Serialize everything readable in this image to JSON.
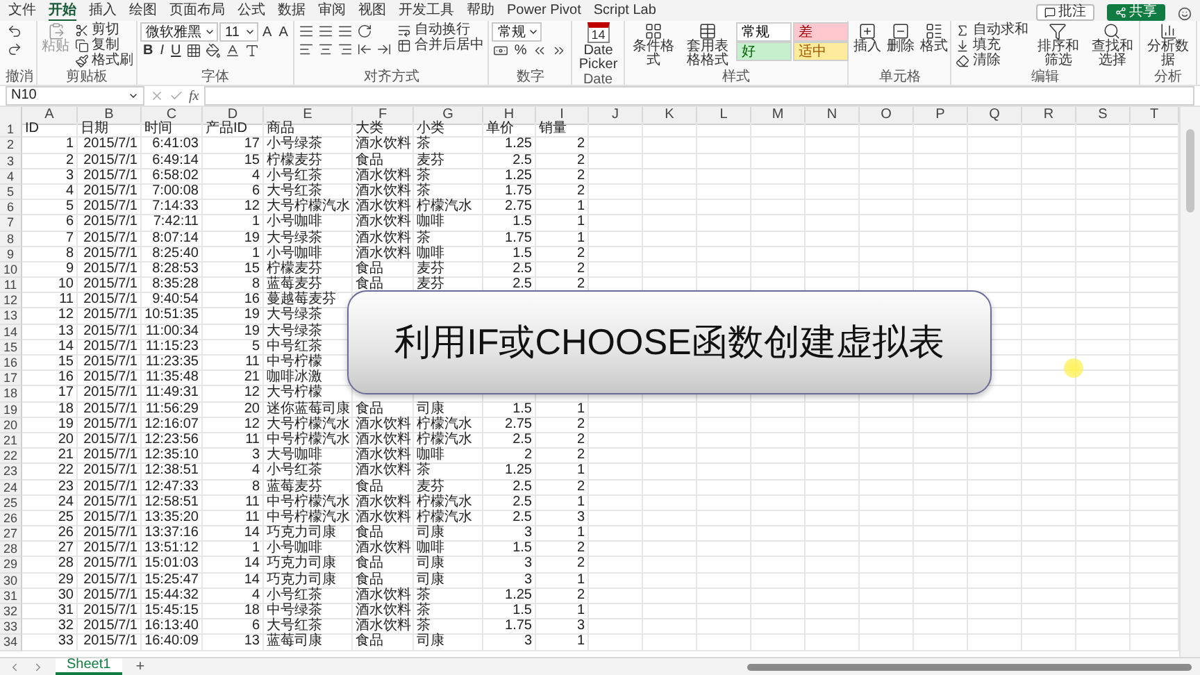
{
  "ribbon_tabs": [
    {
      "label": "文件",
      "selected": false
    },
    {
      "label": "开始",
      "selected": true
    },
    {
      "label": "插入",
      "selected": false
    },
    {
      "label": "绘图",
      "selected": false
    },
    {
      "label": "页面布局",
      "selected": false
    },
    {
      "label": "公式",
      "selected": false
    },
    {
      "label": "数据",
      "selected": false
    },
    {
      "label": "审阅",
      "selected": false
    },
    {
      "label": "视图",
      "selected": false
    },
    {
      "label": "开发工具",
      "selected": false
    },
    {
      "label": "帮助",
      "selected": false
    },
    {
      "label": "Power Pivot",
      "selected": false
    },
    {
      "label": "Script Lab",
      "selected": false
    }
  ],
  "header_buttons": [
    {
      "kind": "comments",
      "label": "批注"
    },
    {
      "kind": "share",
      "label": "共享"
    }
  ],
  "ribbon": [
    {
      "label": "撤消",
      "columns": [
        [
          [
            {
              "kind": "icon"
            }
          ],
          [
            {
              "kind": "icon"
            }
          ]
        ]
      ]
    },
    {
      "label": "剪贴板",
      "columns": [
        [
          [
            {
              "kind": "big",
              "label": "粘贴",
              "disabled": true
            }
          ]
        ],
        [
          [
            {
              "kind": "small",
              "label": "剪切"
            }
          ],
          [
            {
              "kind": "small",
              "label": "复制"
            }
          ],
          [
            {
              "kind": "small",
              "label": "格式刷"
            }
          ]
        ]
      ]
    },
    {
      "label": "字体",
      "columns": [
        [
          [
            {
              "kind": "field",
              "value": "微软雅黑"
            },
            {
              "kind": "field",
              "value": "11"
            },
            {
              "kind": "text",
              "label": "A"
            },
            {
              "kind": "text",
              "label": "A"
            }
          ],
          [
            {
              "kind": "bold",
              "label": "B"
            },
            {
              "kind": "italic",
              "label": "I"
            },
            {
              "kind": "underline",
              "label": "U"
            },
            {
              "kind": "icon"
            },
            {
              "kind": "icon"
            },
            {
              "kind": "icon"
            },
            {
              "kind": "icon"
            }
          ]
        ]
      ]
    },
    {
      "label": "对齐方式",
      "columns": [
        [
          [
            {
              "kind": "icon"
            },
            {
              "kind": "icon"
            },
            {
              "kind": "icon"
            },
            {
              "kind": "icon"
            }
          ],
          [
            {
              "kind": "icon"
            },
            {
              "kind": "icon"
            },
            {
              "kind": "icon"
            },
            {
              "kind": "icon"
            },
            {
              "kind": "icon"
            }
          ]
        ],
        [
          [
            {
              "kind": "small",
              "label": "自动换行"
            }
          ],
          [
            {
              "kind": "small",
              "label": "合并后居中"
            }
          ]
        ]
      ]
    },
    {
      "label": "数字",
      "columns": [
        [
          [
            {
              "kind": "field",
              "value": "常规"
            }
          ],
          [
            {
              "kind": "icon"
            },
            {
              "kind": "text",
              "label": "%"
            },
            {
              "kind": "icon"
            },
            {
              "kind": "icon"
            }
          ]
        ]
      ]
    },
    {
      "label": "Date",
      "columns": [
        [
          [
            {
              "kind": "calendar",
              "day": "14",
              "label": "Date Picker"
            }
          ]
        ]
      ]
    },
    {
      "label": "样式",
      "columns": [
        [
          [
            {
              "kind": "big",
              "label": "条件格式",
              "disabled": false
            }
          ]
        ],
        [
          [
            {
              "kind": "big",
              "label": "套用表格格式",
              "disabled": false
            }
          ]
        ],
        [
          [
            {
              "kind": "style",
              "label": "常规",
              "color": "#ffffff"
            },
            {
              "kind": "style",
              "label": "差",
              "color": "#ffc7ce"
            }
          ],
          [
            {
              "kind": "style",
              "label": "好",
              "color": "#c6efce"
            },
            {
              "kind": "style",
              "label": "适中",
              "color": "#ffeb9c"
            }
          ]
        ]
      ]
    },
    {
      "label": "单元格",
      "columns": [
        [
          [
            {
              "kind": "big",
              "label": "插入",
              "disabled": false
            }
          ]
        ],
        [
          [
            {
              "kind": "big",
              "label": "删除",
              "disabled": false
            }
          ]
        ],
        [
          [
            {
              "kind": "big",
              "label": "格式",
              "disabled": false
            }
          ]
        ]
      ]
    },
    {
      "label": "编辑",
      "columns": [
        [
          [
            {
              "kind": "small",
              "label": "自动求和"
            }
          ],
          [
            {
              "kind": "small",
              "label": "填充"
            }
          ],
          [
            {
              "kind": "small",
              "label": "清除"
            }
          ]
        ],
        [
          [
            {
              "kind": "big",
              "label": "排序和筛选",
              "disabled": false
            }
          ]
        ],
        [
          [
            {
              "kind": "big",
              "label": "查找和选择",
              "disabled": false
            }
          ]
        ]
      ]
    },
    {
      "label": "分析",
      "columns": [
        [
          [
            {
              "kind": "big",
              "label": "分析数据",
              "disabled": false
            }
          ]
        ]
      ]
    }
  ],
  "formula_bar": {
    "name_box": "N10",
    "function_label": "fx"
  },
  "columns": [
    "A",
    "B",
    "C",
    "D",
    "E",
    "F",
    "G",
    "H",
    "I",
    "J",
    "K",
    "L",
    "M",
    "N",
    "O",
    "P",
    "Q",
    "R",
    "S",
    "T"
  ],
  "rows": [
    {
      "n": "1",
      "cells": [
        "ID",
        "日期",
        "时间",
        "产品ID",
        "商品",
        "大类",
        "小类",
        "单价",
        "销量"
      ]
    },
    {
      "n": "2",
      "cells": [
        "1",
        "2015/7/1",
        "6:41:03",
        "17",
        "小号绿茶",
        "酒水饮料",
        "茶",
        "1.25",
        "2"
      ]
    },
    {
      "n": "3",
      "cells": [
        "2",
        "2015/7/1",
        "6:49:14",
        "15",
        "柠檬麦芬",
        "食品",
        "麦芬",
        "2.5",
        "2"
      ]
    },
    {
      "n": "4",
      "cells": [
        "3",
        "2015/7/1",
        "6:58:02",
        "4",
        "小号红茶",
        "酒水饮料",
        "茶",
        "1.25",
        "2"
      ]
    },
    {
      "n": "5",
      "cells": [
        "4",
        "2015/7/1",
        "7:00:08",
        "6",
        "大号红茶",
        "酒水饮料",
        "茶",
        "1.75",
        "2"
      ]
    },
    {
      "n": "6",
      "cells": [
        "5",
        "2015/7/1",
        "7:14:33",
        "12",
        "大号柠檬汽水",
        "酒水饮料",
        "柠檬汽水",
        "2.75",
        "1"
      ]
    },
    {
      "n": "7",
      "cells": [
        "6",
        "2015/7/1",
        "7:42:11",
        "1",
        "小号咖啡",
        "酒水饮料",
        "咖啡",
        "1.5",
        "1"
      ]
    },
    {
      "n": "8",
      "cells": [
        "7",
        "2015/7/1",
        "8:07:14",
        "19",
        "大号绿茶",
        "酒水饮料",
        "茶",
        "1.75",
        "1"
      ]
    },
    {
      "n": "9",
      "cells": [
        "8",
        "2015/7/1",
        "8:25:40",
        "1",
        "小号咖啡",
        "酒水饮料",
        "咖啡",
        "1.5",
        "2"
      ]
    },
    {
      "n": "10",
      "cells": [
        "9",
        "2015/7/1",
        "8:28:53",
        "15",
        "柠檬麦芬",
        "食品",
        "麦芬",
        "2.5",
        "2"
      ]
    },
    {
      "n": "11",
      "cells": [
        "10",
        "2015/7/1",
        "8:35:28",
        "8",
        "蓝莓麦芬",
        "食品",
        "麦芬",
        "2.5",
        "2"
      ]
    },
    {
      "n": "12",
      "cells": [
        "11",
        "2015/7/1",
        "9:40:54",
        "16",
        "蔓越莓麦芬"
      ]
    },
    {
      "n": "13",
      "cells": [
        "12",
        "2015/7/1",
        "10:51:35",
        "19",
        "大号绿茶"
      ]
    },
    {
      "n": "14",
      "cells": [
        "13",
        "2015/7/1",
        "11:00:34",
        "19",
        "大号绿茶"
      ]
    },
    {
      "n": "15",
      "cells": [
        "14",
        "2015/7/1",
        "11:15:23",
        "5",
        "中号红茶"
      ]
    },
    {
      "n": "16",
      "cells": [
        "15",
        "2015/7/1",
        "11:23:35",
        "11",
        "中号柠檬"
      ]
    },
    {
      "n": "17",
      "cells": [
        "16",
        "2015/7/1",
        "11:35:48",
        "21",
        "咖啡冰激"
      ]
    },
    {
      "n": "18",
      "cells": [
        "17",
        "2015/7/1",
        "11:49:31",
        "12",
        "大号柠檬"
      ]
    },
    {
      "n": "19",
      "cells": [
        "18",
        "2015/7/1",
        "11:56:29",
        "20",
        "迷你蓝莓司康",
        "食品",
        "司康",
        "1.5",
        "1"
      ]
    },
    {
      "n": "20",
      "cells": [
        "19",
        "2015/7/1",
        "12:16:07",
        "12",
        "大号柠檬汽水",
        "酒水饮料",
        "柠檬汽水",
        "2.75",
        "2"
      ]
    },
    {
      "n": "21",
      "cells": [
        "20",
        "2015/7/1",
        "12:23:56",
        "11",
        "中号柠檬汽水",
        "酒水饮料",
        "柠檬汽水",
        "2.5",
        "2"
      ]
    },
    {
      "n": "22",
      "cells": [
        "21",
        "2015/7/1",
        "12:35:10",
        "3",
        "大号咖啡",
        "酒水饮料",
        "咖啡",
        "2",
        "2"
      ]
    },
    {
      "n": "23",
      "cells": [
        "22",
        "2015/7/1",
        "12:38:51",
        "4",
        "小号红茶",
        "酒水饮料",
        "茶",
        "1.25",
        "1"
      ]
    },
    {
      "n": "24",
      "cells": [
        "23",
        "2015/7/1",
        "12:47:33",
        "8",
        "蓝莓麦芬",
        "食品",
        "麦芬",
        "2.5",
        "2"
      ]
    },
    {
      "n": "25",
      "cells": [
        "24",
        "2015/7/1",
        "12:58:51",
        "11",
        "中号柠檬汽水",
        "酒水饮料",
        "柠檬汽水",
        "2.5",
        "1"
      ]
    },
    {
      "n": "26",
      "cells": [
        "25",
        "2015/7/1",
        "13:35:20",
        "11",
        "中号柠檬汽水",
        "酒水饮料",
        "柠檬汽水",
        "2.5",
        "3"
      ]
    },
    {
      "n": "27",
      "cells": [
        "26",
        "2015/7/1",
        "13:37:16",
        "14",
        "巧克力司康",
        "食品",
        "司康",
        "3",
        "1"
      ]
    },
    {
      "n": "28",
      "cells": [
        "27",
        "2015/7/1",
        "13:51:12",
        "1",
        "小号咖啡",
        "酒水饮料",
        "咖啡",
        "1.5",
        "2"
      ]
    },
    {
      "n": "29",
      "cells": [
        "28",
        "2015/7/1",
        "15:01:03",
        "14",
        "巧克力司康",
        "食品",
        "司康",
        "3",
        "2"
      ]
    },
    {
      "n": "30",
      "cells": [
        "29",
        "2015/7/1",
        "15:25:47",
        "14",
        "巧克力司康",
        "食品",
        "司康",
        "3",
        "1"
      ]
    },
    {
      "n": "31",
      "cells": [
        "30",
        "2015/7/1",
        "15:44:32",
        "4",
        "小号红茶",
        "酒水饮料",
        "茶",
        "1.25",
        "2"
      ]
    },
    {
      "n": "32",
      "cells": [
        "31",
        "2015/7/1",
        "15:45:15",
        "18",
        "中号绿茶",
        "酒水饮料",
        "茶",
        "1.5",
        "1"
      ]
    },
    {
      "n": "33",
      "cells": [
        "32",
        "2015/7/1",
        "16:13:40",
        "6",
        "大号红茶",
        "酒水饮料",
        "茶",
        "1.75",
        "3"
      ]
    },
    {
      "n": "34",
      "cells": [
        "33",
        "2015/7/1",
        "16:40:09",
        "13",
        "蓝莓司康",
        "食品",
        "司康",
        "3",
        "1"
      ]
    }
  ],
  "banner": "利用IF或CHOOSE函数创建虚拟表",
  "sheet_tabs": [
    {
      "label": "Sheet1",
      "selected": true
    }
  ],
  "add_sheet": "+"
}
